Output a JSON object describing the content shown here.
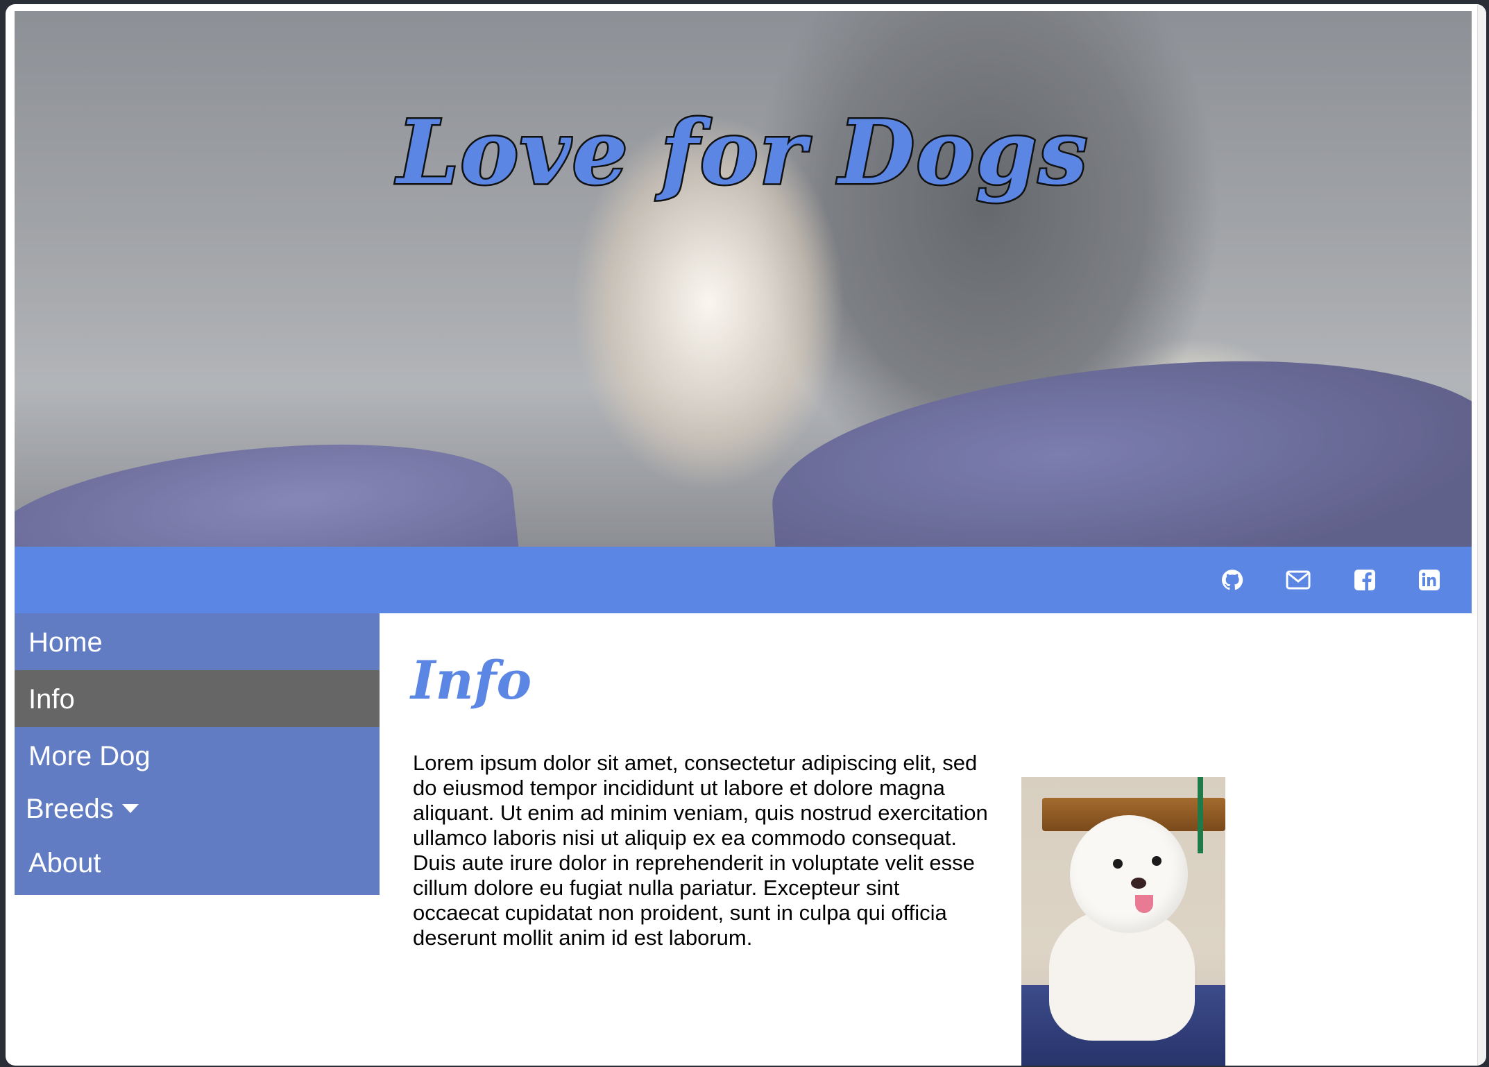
{
  "site": {
    "title": "Love for Dogs"
  },
  "social": {
    "icons": [
      "github-icon",
      "mail-icon",
      "facebook-icon",
      "linkedin-icon"
    ],
    "bar_color": "#5b86e3"
  },
  "nav": {
    "items": [
      {
        "label": "Home",
        "active": false
      },
      {
        "label": "Info",
        "active": true
      },
      {
        "label": "More Dog",
        "active": false
      },
      {
        "label": "Breeds",
        "active": false,
        "dropdown": true
      },
      {
        "label": "About",
        "active": false
      }
    ],
    "bg_color": "#627cc3",
    "active_color": "#666666"
  },
  "main": {
    "heading": "Info",
    "body": "Lorem ipsum dolor sit amet, consectetur adipiscing elit, sed do eiusmod tempor incididunt ut labore et dolore magna aliquant. Ut enim ad minim veniam, quis nostrud exercitation ullamco laboris nisi ut aliquip ex ea commodo consequat. Duis aute irure dolor in reprehenderit in voluptate velit esse cillum dolore eu fugiat nulla pariatur. Excepteur sint occaecat cupidatat non proident, sunt in culpa qui officia deserunt mollit anim id est laborum."
  },
  "colors": {
    "accent": "#5b86e3",
    "text": "#000000"
  }
}
